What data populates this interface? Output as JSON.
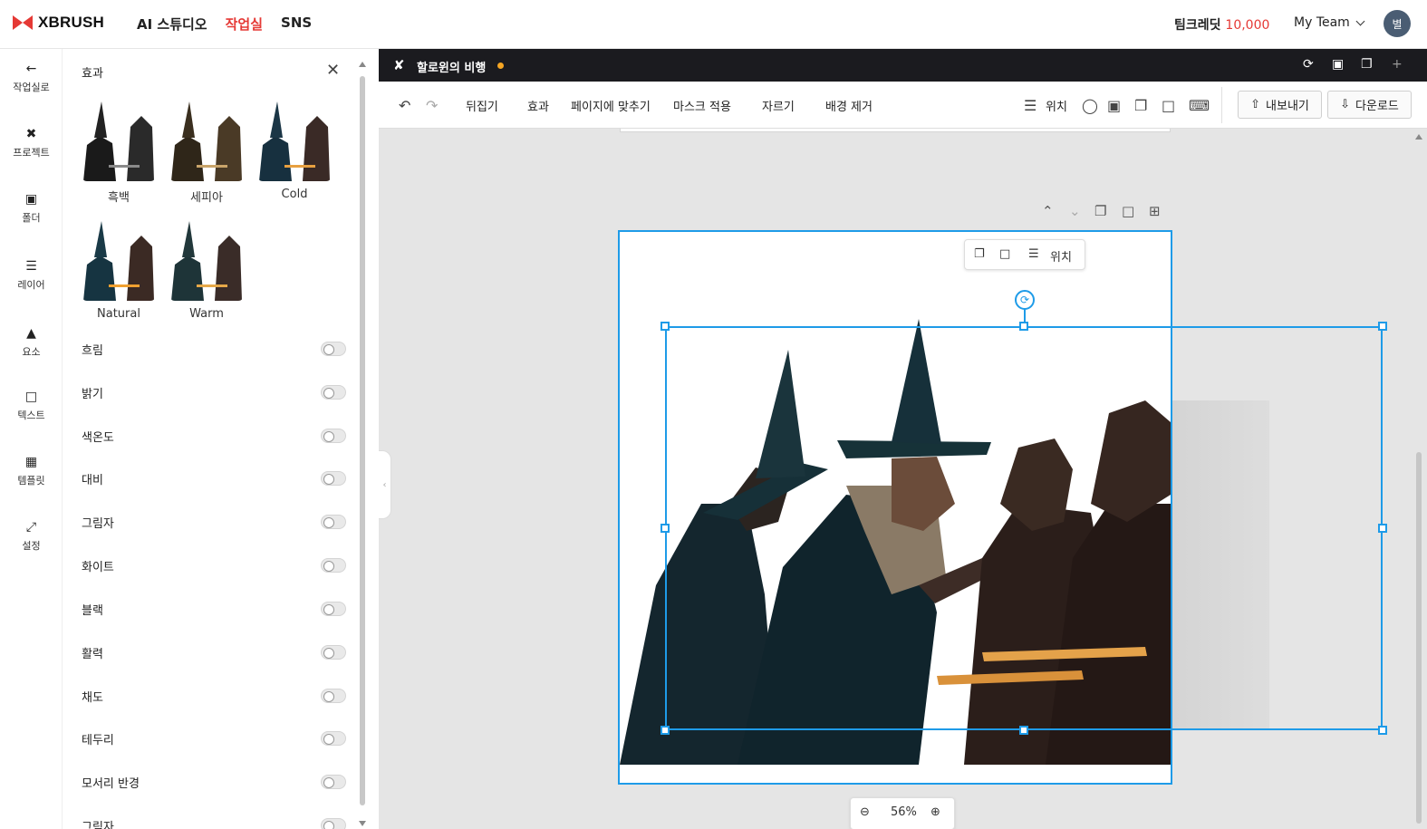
{
  "brand": {
    "name": "XBRUSH"
  },
  "nav": {
    "items": [
      {
        "label": "AI 스튜디오"
      },
      {
        "label": "작업실",
        "active": true
      },
      {
        "label": "SNS"
      }
    ]
  },
  "account": {
    "credit_label": "팀크레딧",
    "credit_value": "10,000",
    "team": "My Team",
    "avatar": "별"
  },
  "rail": {
    "items": [
      {
        "label": "작업실로",
        "icon": "arrow-left-icon"
      },
      {
        "label": "프로젝트",
        "icon": "project-icon"
      },
      {
        "label": "폴더",
        "icon": "folder-icon"
      },
      {
        "label": "레이어",
        "icon": "layers-icon"
      },
      {
        "label": "요소",
        "icon": "shapes-icon"
      },
      {
        "label": "텍스트",
        "icon": "text-icon"
      },
      {
        "label": "템플릿",
        "icon": "template-icon"
      },
      {
        "label": "설정",
        "icon": "expand-icon"
      }
    ]
  },
  "panel": {
    "title": "효과",
    "filters": [
      {
        "label": "흑백",
        "tint": "#3a3a3a"
      },
      {
        "label": "세피아",
        "tint": "#5a4a32"
      },
      {
        "label": "Cold",
        "tint": "#23384a"
      },
      {
        "label": "Natural",
        "tint": "#1f3a45"
      },
      {
        "label": "Warm",
        "tint": "#2b3b3c"
      }
    ],
    "toggles": [
      {
        "label": "흐림"
      },
      {
        "label": "밝기"
      },
      {
        "label": "색온도"
      },
      {
        "label": "대비"
      },
      {
        "label": "그림자"
      },
      {
        "label": "화이트"
      },
      {
        "label": "블랙"
      },
      {
        "label": "활력"
      },
      {
        "label": "채도"
      },
      {
        "label": "테두리"
      },
      {
        "label": "모서리 반경"
      },
      {
        "label": "그림자"
      }
    ]
  },
  "editor": {
    "title": "할로윈의 비행",
    "unsaved_color": "#f5a623",
    "toolbar": {
      "flip": "뒤집기",
      "effect": "효과",
      "fit": "페이지에 맞추기",
      "mask": "마스크 적용",
      "crop": "자르기",
      "remove_bg": "배경 제거",
      "position": "위치",
      "export": "내보내기",
      "download": "다운로드"
    },
    "float_position": "위치",
    "zoom": "56%"
  },
  "colors": {
    "accent": "#e53935",
    "selection": "#1e9be8"
  }
}
